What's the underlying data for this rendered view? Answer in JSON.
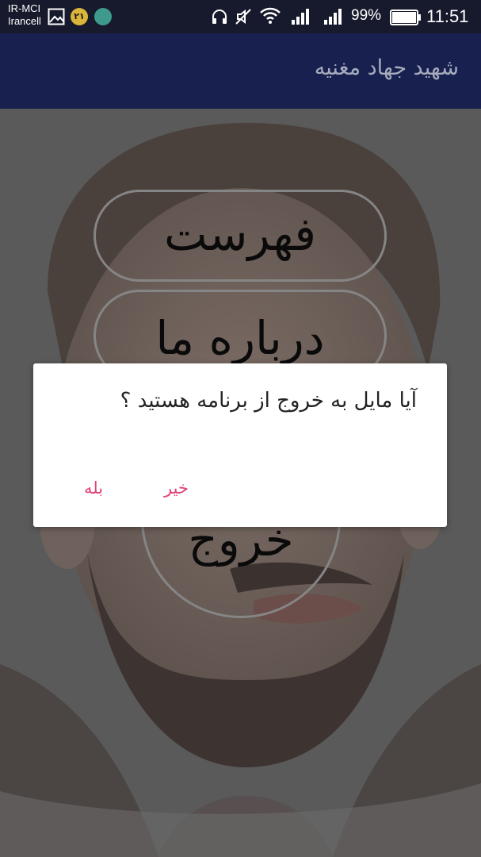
{
  "status_bar": {
    "carrier_primary": "IR-MCI",
    "carrier_secondary": "Irancell",
    "badge_number": "۲۱",
    "battery_percent": "99%",
    "time": "11:51",
    "icons": [
      "gallery-icon",
      "notification-badge-icon",
      "app-notification-icon",
      "headphone-icon",
      "vibrate-off-icon",
      "wifi-icon",
      "signal-icon",
      "signal-icon",
      "battery-icon"
    ]
  },
  "app_bar": {
    "title": "شهید جهاد مغنیه",
    "color": "#17204f"
  },
  "menu": {
    "index_label": "فهرست",
    "about_label": "درباره ما",
    "exit_label": "خروج"
  },
  "dialog": {
    "message": "آیا مایل به خروج از برنامه هستید ؟",
    "no_label": "خیر",
    "yes_label": "بله",
    "accent_color": "#e0447a"
  }
}
